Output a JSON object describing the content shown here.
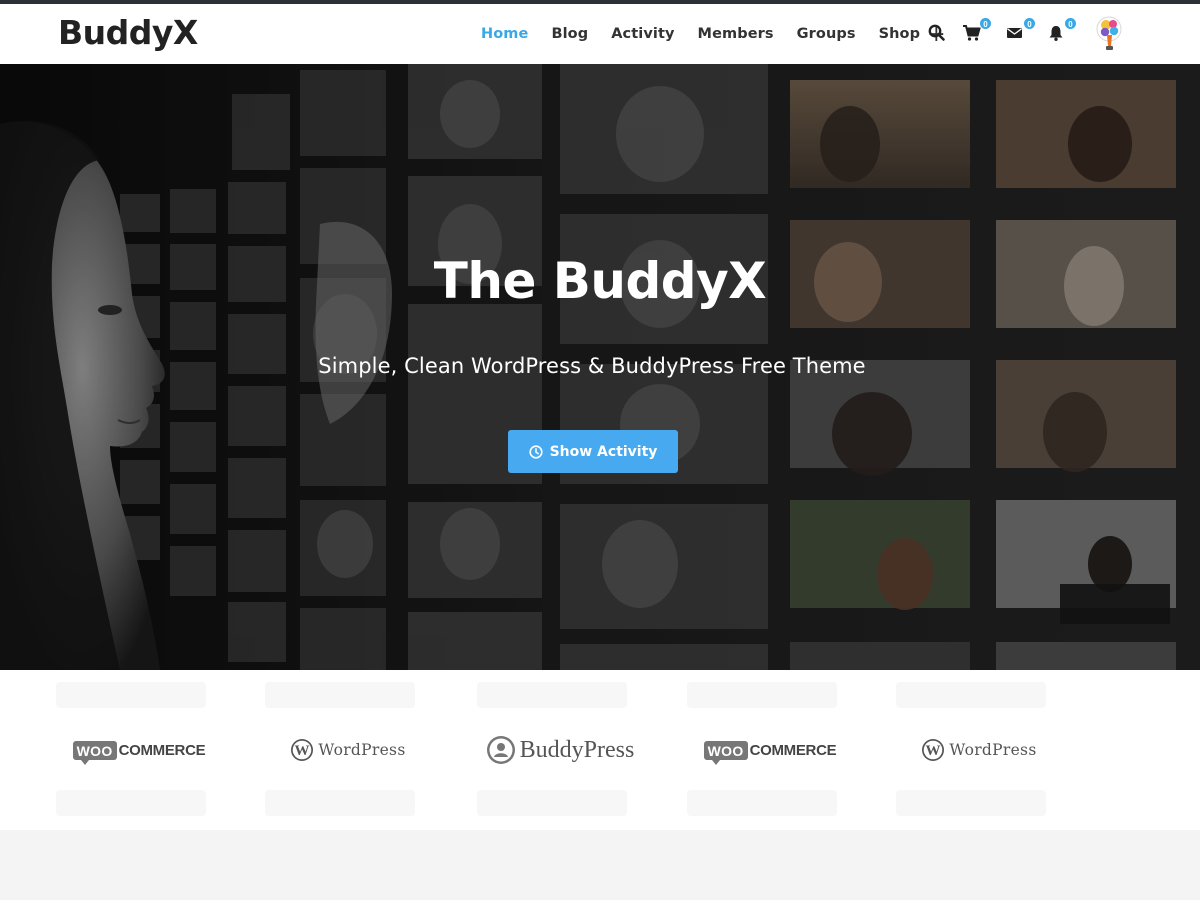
{
  "brand": {
    "name": "BuddyX"
  },
  "nav": {
    "items": [
      {
        "label": "Home",
        "active": true
      },
      {
        "label": "Blog",
        "active": false
      },
      {
        "label": "Activity",
        "active": false
      },
      {
        "label": "Members",
        "active": false
      },
      {
        "label": "Groups",
        "active": false
      },
      {
        "label": "Shop",
        "active": false
      }
    ],
    "submenu_indicator": "+"
  },
  "header_icons": {
    "search": {
      "icon": "search-icon"
    },
    "cart": {
      "icon": "cart-icon",
      "count": "0"
    },
    "messages": {
      "icon": "envelope-icon",
      "count": "0"
    },
    "notifications": {
      "icon": "bell-icon",
      "count": "0"
    },
    "avatar": {
      "icon": "user-avatar"
    }
  },
  "hero": {
    "title": "The BuddyX",
    "subtitle": "Simple, Clean WordPress & BuddyPress Free Theme",
    "button_label": "Show Activity",
    "button_icon": "clock-icon"
  },
  "partners": {
    "items": [
      {
        "logo": "woocommerce-logo",
        "badge": "WOO",
        "text": "COMMERCE"
      },
      {
        "logo": "wordpress-logo",
        "text": "WordPress"
      },
      {
        "logo": "buddypress-logo",
        "text": "BuddyPress"
      },
      {
        "logo": "woocommerce-logo",
        "badge": "WOO",
        "text": "COMMERCE"
      },
      {
        "logo": "wordpress-logo",
        "text": "WordPress"
      }
    ]
  },
  "colors": {
    "accent": "#38a8e6",
    "button": "#47aaf0",
    "header_bg": "#ffffff",
    "hero_bg": "#141414"
  }
}
